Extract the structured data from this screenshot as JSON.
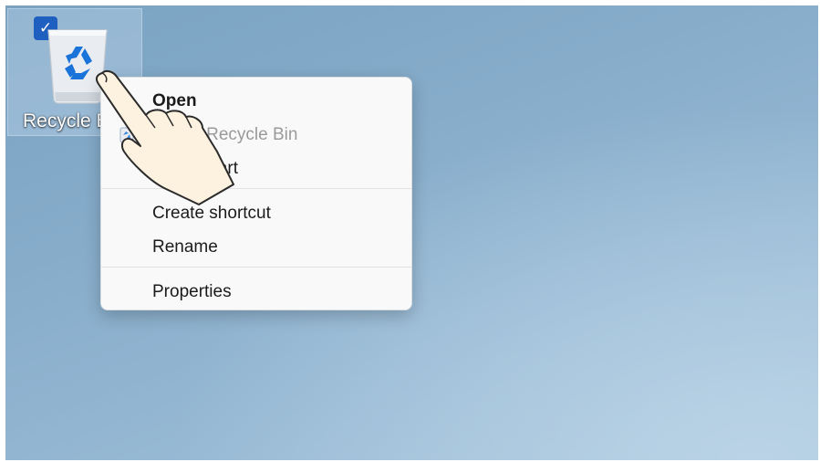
{
  "desktop": {
    "icon": {
      "label": "Recycle Bin",
      "icon": "recycle-bin-icon",
      "selected": true
    }
  },
  "context_menu": {
    "items": [
      {
        "label": "Open",
        "bold": true,
        "enabled": true
      },
      {
        "label": "Empty Recycle Bin",
        "enabled": false,
        "icon": "recycle-bin-icon"
      },
      {
        "label": "Pin to Start",
        "enabled": true
      },
      {
        "label": "Create shortcut",
        "enabled": true
      },
      {
        "label": "Rename",
        "enabled": true
      },
      {
        "label": "Properties",
        "enabled": true
      }
    ]
  },
  "overlay": {
    "icon": "pointing-hand-icon"
  },
  "colors": {
    "accent": "#1f5fbf",
    "recycle": "#1a73d9"
  }
}
